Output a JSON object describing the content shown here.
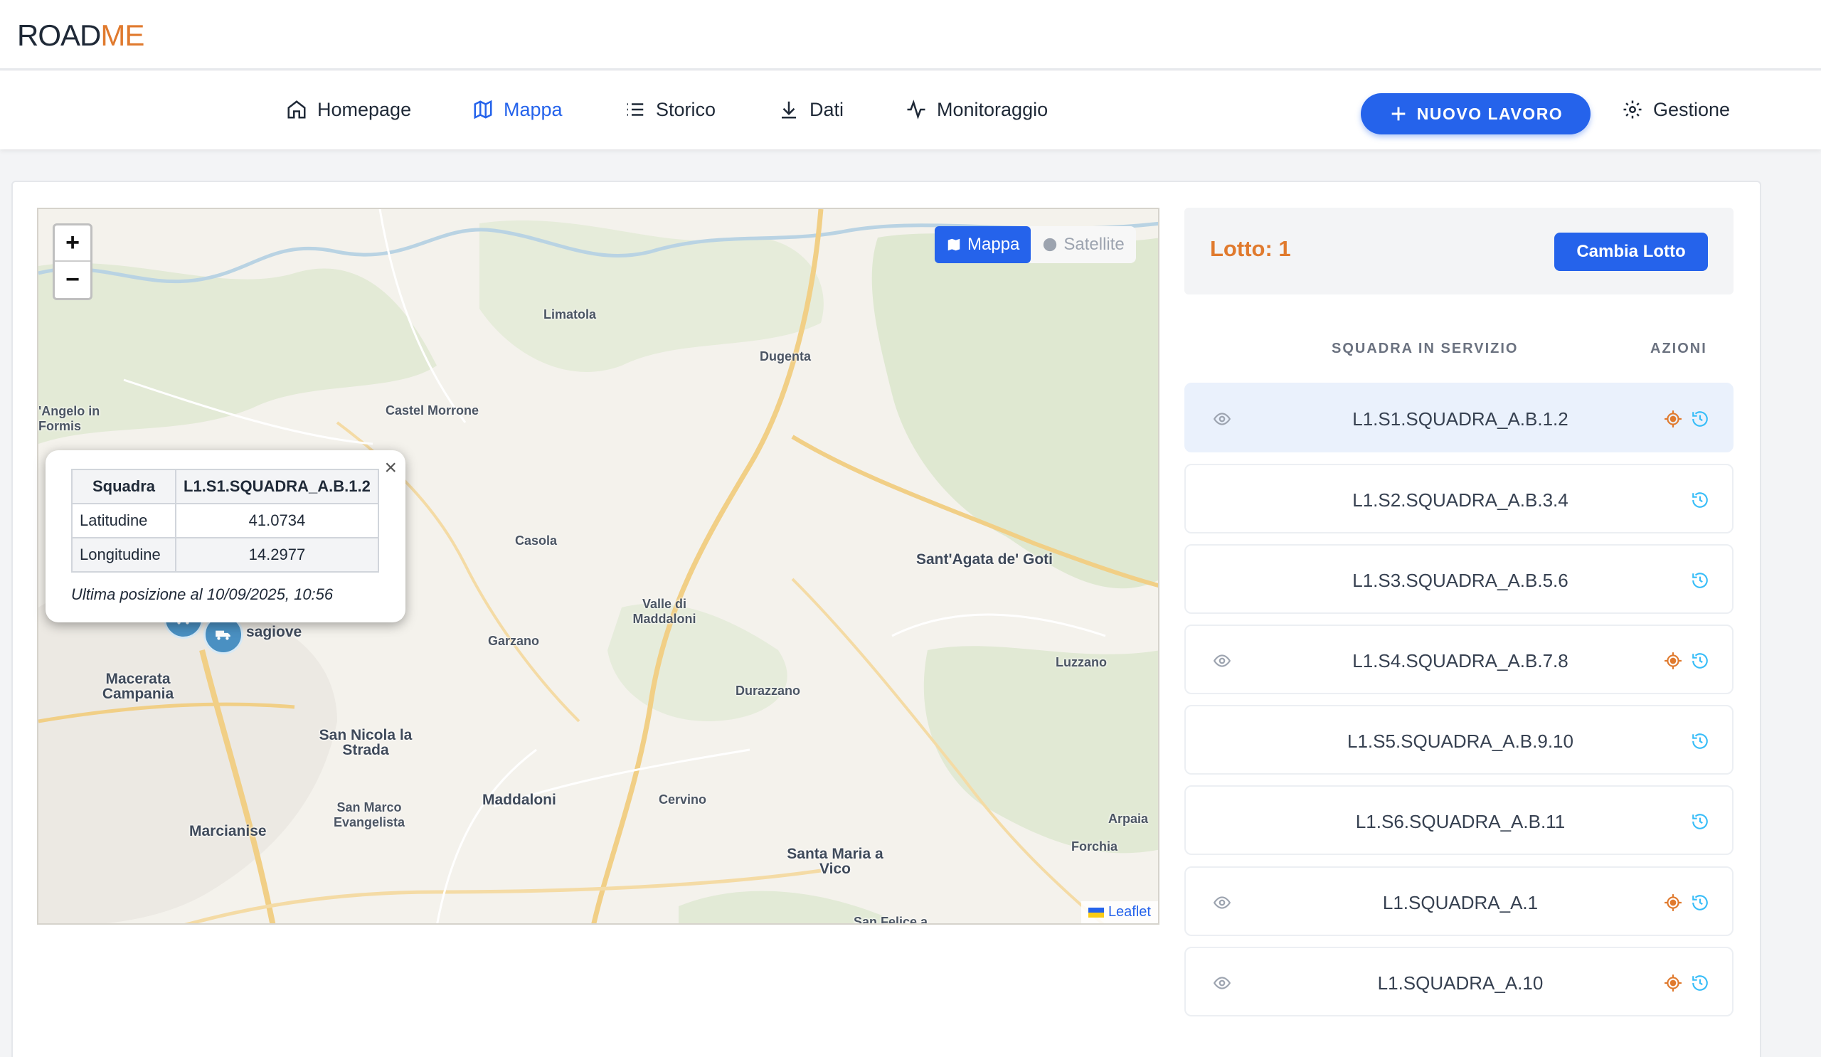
{
  "app": {
    "logo_main": "ROAD",
    "logo_accent": "ME"
  },
  "nav": {
    "items": [
      {
        "label": "Homepage",
        "icon": "home-icon"
      },
      {
        "label": "Mappa",
        "icon": "map-icon",
        "active": true
      },
      {
        "label": "Storico",
        "icon": "list-icon"
      },
      {
        "label": "Dati",
        "icon": "download-icon"
      },
      {
        "label": "Monitoraggio",
        "icon": "activity-icon"
      }
    ],
    "new_job_label": "NUOVO LAVORO",
    "settings_label": "Gestione"
  },
  "map": {
    "type_map": "Mappa",
    "type_satellite": "Satellite",
    "attribution": "Leaflet",
    "places": [
      "Limatola",
      "Dugenta",
      "Castel Morrone",
      "'Angelo in Formis",
      "Casola",
      "Sant'Agata de' Goti",
      "Valle di Maddaloni",
      "Garzano",
      "sagiove",
      "Macerata Campania",
      "Luzzano",
      "Durazzano",
      "San Nicola la Strada",
      "San Marco Evangelista",
      "Maddaloni",
      "Cervino",
      "Marcianise",
      "Arpaia",
      "Forchia",
      "Santa Maria a Vico",
      "San Felice a"
    ],
    "popup": {
      "header_key": "Squadra",
      "header_value": "L1.S1.SQUADRA_A.B.1.2",
      "rows": [
        {
          "key": "Latitudine",
          "value": "41.0734"
        },
        {
          "key": "Longitudine",
          "value": "14.2977"
        }
      ],
      "note": "Ultima posizione al 10/09/2025, 10:56"
    }
  },
  "panel": {
    "lot_label": "Lotto: 1",
    "change_lot_label": "Cambia Lotto",
    "col_team": "SQUADRA IN SERVIZIO",
    "col_actions": "AZIONI",
    "teams": [
      {
        "name": "L1.S1.SQUADRA_A.B.1.2",
        "selected": true,
        "has_position": true
      },
      {
        "name": "L1.S2.SQUADRA_A.B.3.4",
        "has_position": false
      },
      {
        "name": "L1.S3.SQUADRA_A.B.5.6",
        "has_position": false
      },
      {
        "name": "L1.S4.SQUADRA_A.B.7.8",
        "has_position": true
      },
      {
        "name": "L1.S5.SQUADRA_A.B.9.10",
        "has_position": false
      },
      {
        "name": "L1.S6.SQUADRA_A.B.11",
        "has_position": false
      },
      {
        "name": "L1.SQUADRA_A.1",
        "has_position": true
      },
      {
        "name": "L1.SQUADRA_A.10",
        "has_position": true
      }
    ]
  },
  "colors": {
    "primary": "#2563eb",
    "accent": "#e07a2e",
    "history": "#38bdf8"
  }
}
